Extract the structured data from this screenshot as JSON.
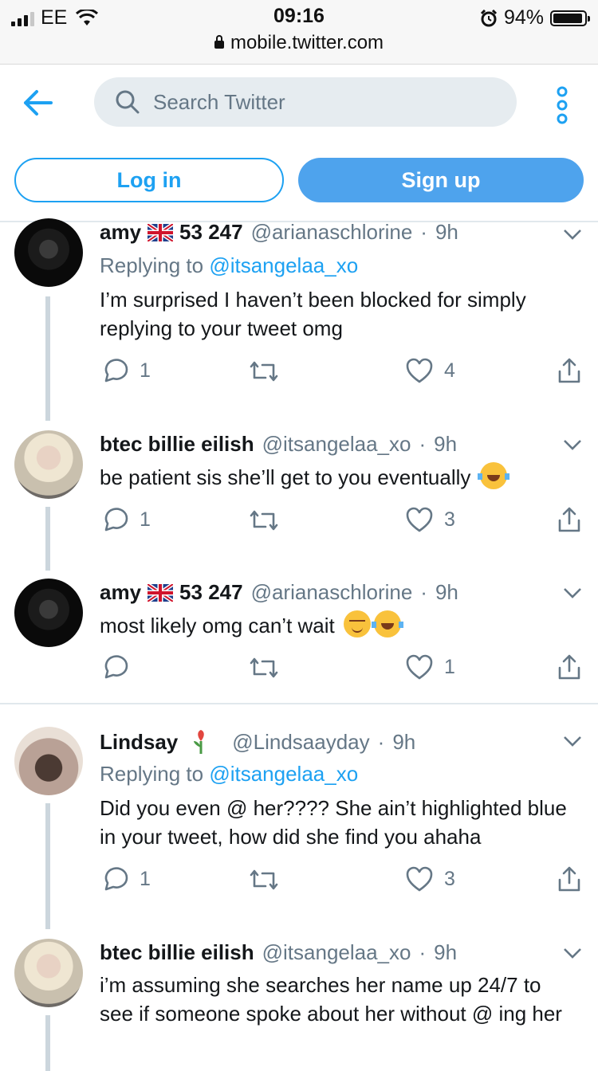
{
  "status_bar": {
    "carrier": "EE",
    "time": "09:16",
    "url": "mobile.twitter.com",
    "battery": "94%",
    "battery_level": 0.94
  },
  "header": {
    "search_placeholder": "Search Twitter",
    "login_label": "Log in",
    "signup_label": "Sign up"
  },
  "tweets": [
    {
      "name": "amy",
      "name_suffix": "53 247",
      "handle": "@arianaschlorine",
      "dot": "·",
      "time": "9h",
      "replying_prefix": "Replying to",
      "replying_to": "@itsangelaa_xo",
      "text": "I’m surprised I haven’t been blocked for simply replying to your tweet omg",
      "replies": "1",
      "likes": "4"
    },
    {
      "name": "btec billie eilish",
      "handle": "@itsangelaa_xo",
      "dot": "·",
      "time": "9h",
      "text": "be patient sis she’ll get to you eventually",
      "replies": "1",
      "likes": "3"
    },
    {
      "name": "amy",
      "name_suffix": "53 247",
      "handle": "@arianaschlorine",
      "dot": "·",
      "time": "9h",
      "text": "most likely omg can’t wait",
      "likes": "1"
    },
    {
      "name": "Lindsay",
      "handle": "@Lindsaayday",
      "dot": "·",
      "time": "9h",
      "replying_prefix": "Replying to",
      "replying_to": "@itsangelaa_xo",
      "text": "Did you even @ her???? She ain’t highlighted blue in your tweet, how did she find you ahaha",
      "replies": "1",
      "likes": "3"
    },
    {
      "name": "btec billie eilish",
      "handle": "@itsangelaa_xo",
      "dot": "·",
      "time": "9h",
      "text": "i’m assuming she searches her name up 24/7 to see if someone spoke about her without @ ing her"
    }
  ],
  "colors": {
    "twitter_blue": "#1da1f2",
    "signup_bg": "#4ea3ed",
    "muted_text": "#657786",
    "thread_line": "#ccd6dd"
  }
}
